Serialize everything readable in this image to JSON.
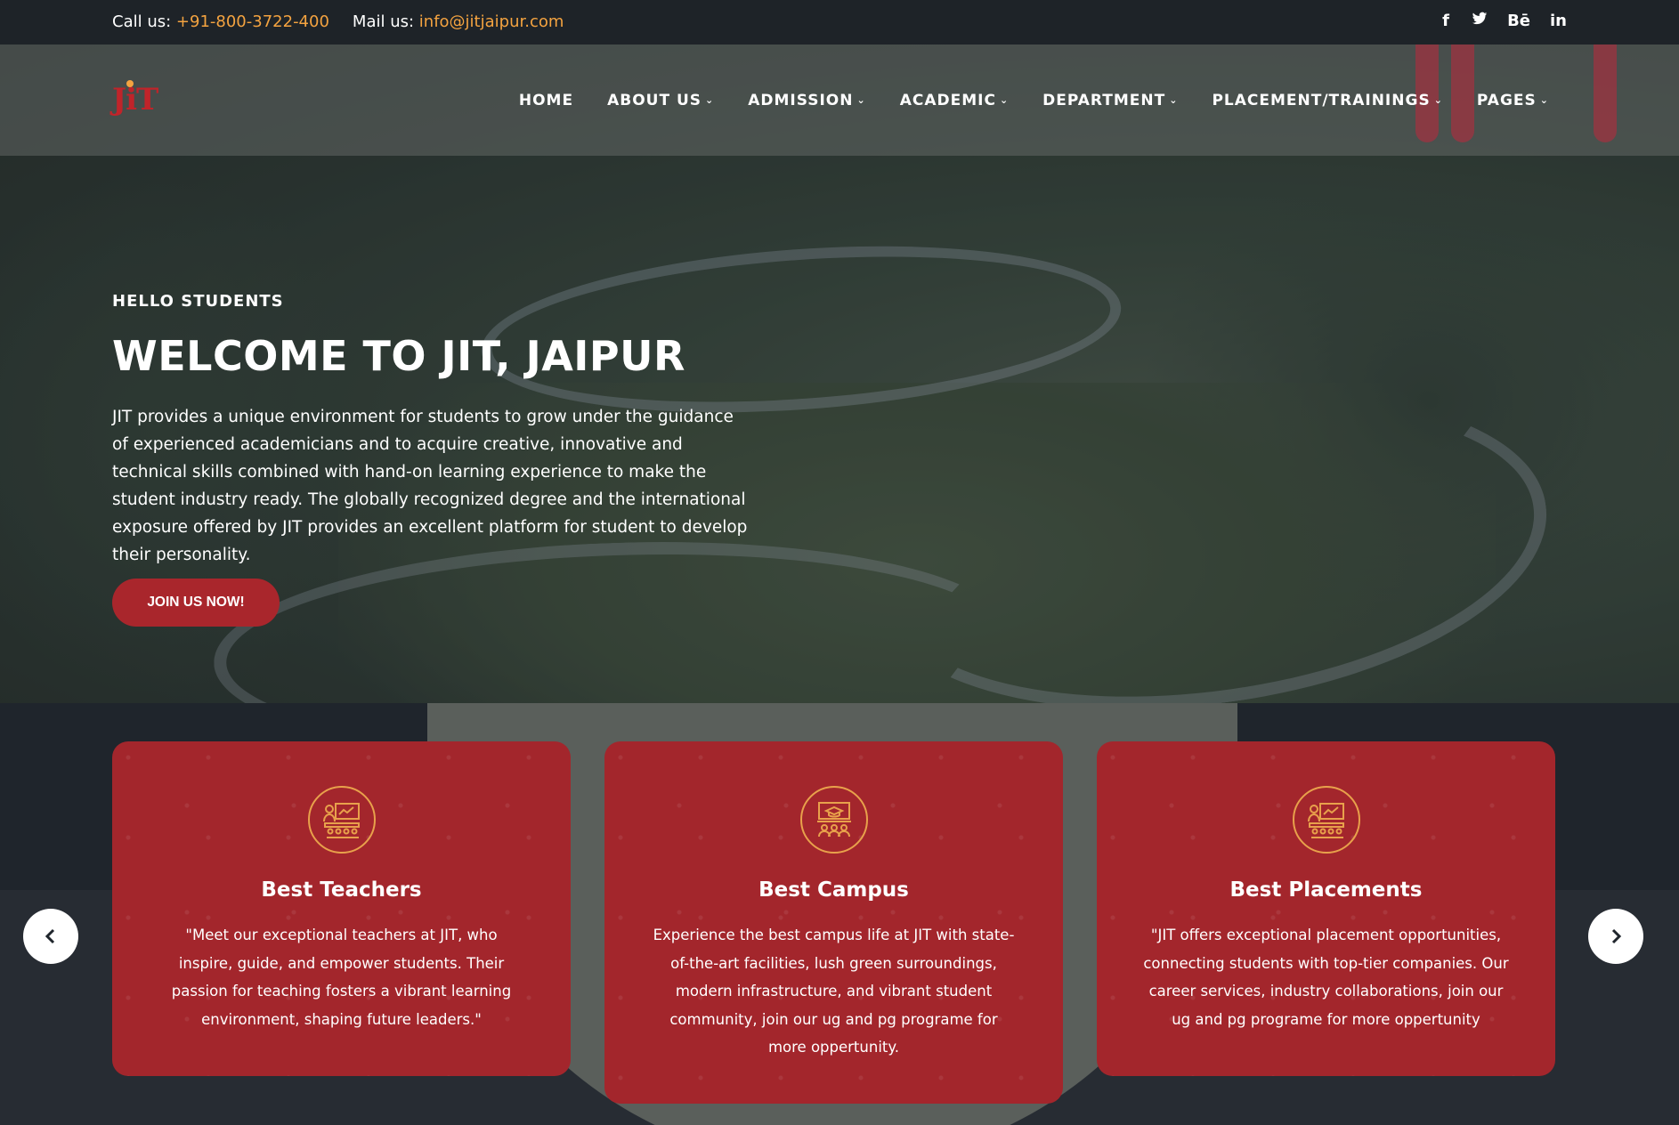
{
  "topbar": {
    "call_label": "Call us:",
    "call_value": "+91-800-3722-400",
    "mail_label": "Mail us:",
    "mail_value": "info@jitjaipur.com",
    "social": [
      "f",
      "t",
      "Bē",
      "in"
    ]
  },
  "logo": {
    "text": "JiT"
  },
  "nav": {
    "items": [
      {
        "label": "HOME",
        "has_dropdown": false
      },
      {
        "label": "ABOUT US",
        "has_dropdown": true
      },
      {
        "label": "ADMISSION",
        "has_dropdown": true
      },
      {
        "label": "ACADEMIC",
        "has_dropdown": true
      },
      {
        "label": "DEPARTMENT",
        "has_dropdown": true
      },
      {
        "label": "PLACEMENT/TRAININGS",
        "has_dropdown": true
      },
      {
        "label": "PAGES",
        "has_dropdown": true
      }
    ]
  },
  "hero": {
    "eyebrow": "HELLO STUDENTS",
    "headline": "WELCOME TO JIT, JAIPUR",
    "lead": "JIT provides a unique environment for students to grow under the guidance of experienced academicians and to acquire creative, innovative and technical skills combined with hand-on learning experience to make the student industry ready. The globally recognized degree and the international exposure offered by JIT provides an excellent platform for student to develop their personality.",
    "cta": "JOIN US NOW!"
  },
  "features": [
    {
      "title": "Best Teachers",
      "body": "\"Meet our exceptional teachers at JIT, who inspire, guide, and empower students. Their passion for teaching fosters a vibrant learning environment, shaping future leaders.\"",
      "icon": "classroom-icon"
    },
    {
      "title": "Best Campus",
      "body": "Experience the best campus life at JIT with state-of-the-art facilities, lush green surroundings, modern infrastructure, and vibrant student community, join our ug and pg programe for more oppertunity.",
      "icon": "campus-board-icon"
    },
    {
      "title": "Best Placements",
      "body": "\"JIT offers exceptional placement opportunities, connecting students with top-tier companies. Our career services, industry collaborations, join our ug and pg programe for more oppertunity",
      "icon": "classroom-icon"
    }
  ],
  "carousel": {
    "prev": "‹",
    "next": "›"
  },
  "colors": {
    "accent": "#f4a340",
    "brand_red": "#a3262c",
    "dark": "#1e2328"
  }
}
